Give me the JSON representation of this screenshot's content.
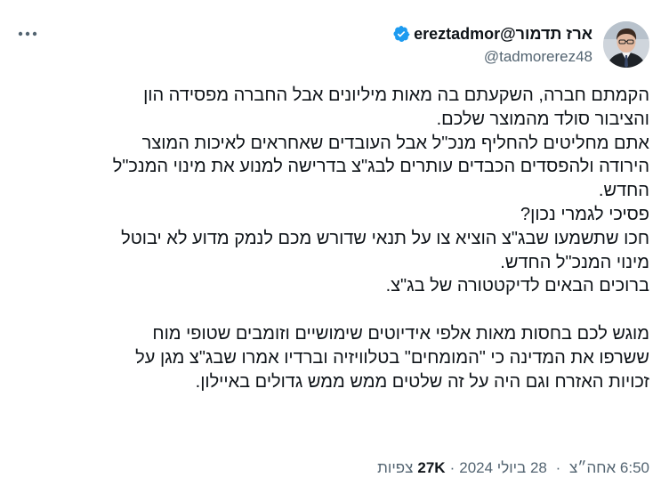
{
  "tweet": {
    "author": {
      "display_name": "ארז תדמור@ereztadmor",
      "handle": "@tadmorerez48",
      "verified": true,
      "verified_color": "#1d9bf0",
      "avatar_icon": "person-avatar"
    },
    "more_icon": "ellipsis-icon",
    "text_lines": [
      "הקמתם חברה, השקעתם בה מאות מיליונים אבל החברה מפסידה הון",
      "והציבור סולד מהמוצר שלכם.",
      "אתם מחליטים להחליף מנכ\"ל אבל העובדים שאחראים לאיכות המוצר",
      "הירודה ולהפסדים הכבדים עותרים לבג\"צ  בדרישה למנוע את מינוי המנכ\"ל",
      "החדש.",
      "פסיכי לגמרי נכון?",
      "חכו שתשמעו שבג\"צ הוציא צו על תנאי שדורש מכם לנמק מדוע לא יבוטל",
      "מינוי המנכ\"ל החדש.",
      "ברוכים הבאים לדיקטטורה של בג\"צ.",
      "",
      "מוגש לכם בחסות מאות אלפי אידיוטים שימושיים וזומבים שטופי מוח",
      "ששרפו את המדינה כי \"המומחים\" בטלוויזיה וברדיו אמרו שבג\"צ מגן על",
      "זכויות האזרח וגם היה על זה שלטים ממש ממש גדולים באיילון."
    ],
    "meta": {
      "time": "6:50 אחה״צ",
      "date": "28 ביולי 2024",
      "views_count": "27K",
      "views_label": "צפיות",
      "separator": "·"
    }
  }
}
